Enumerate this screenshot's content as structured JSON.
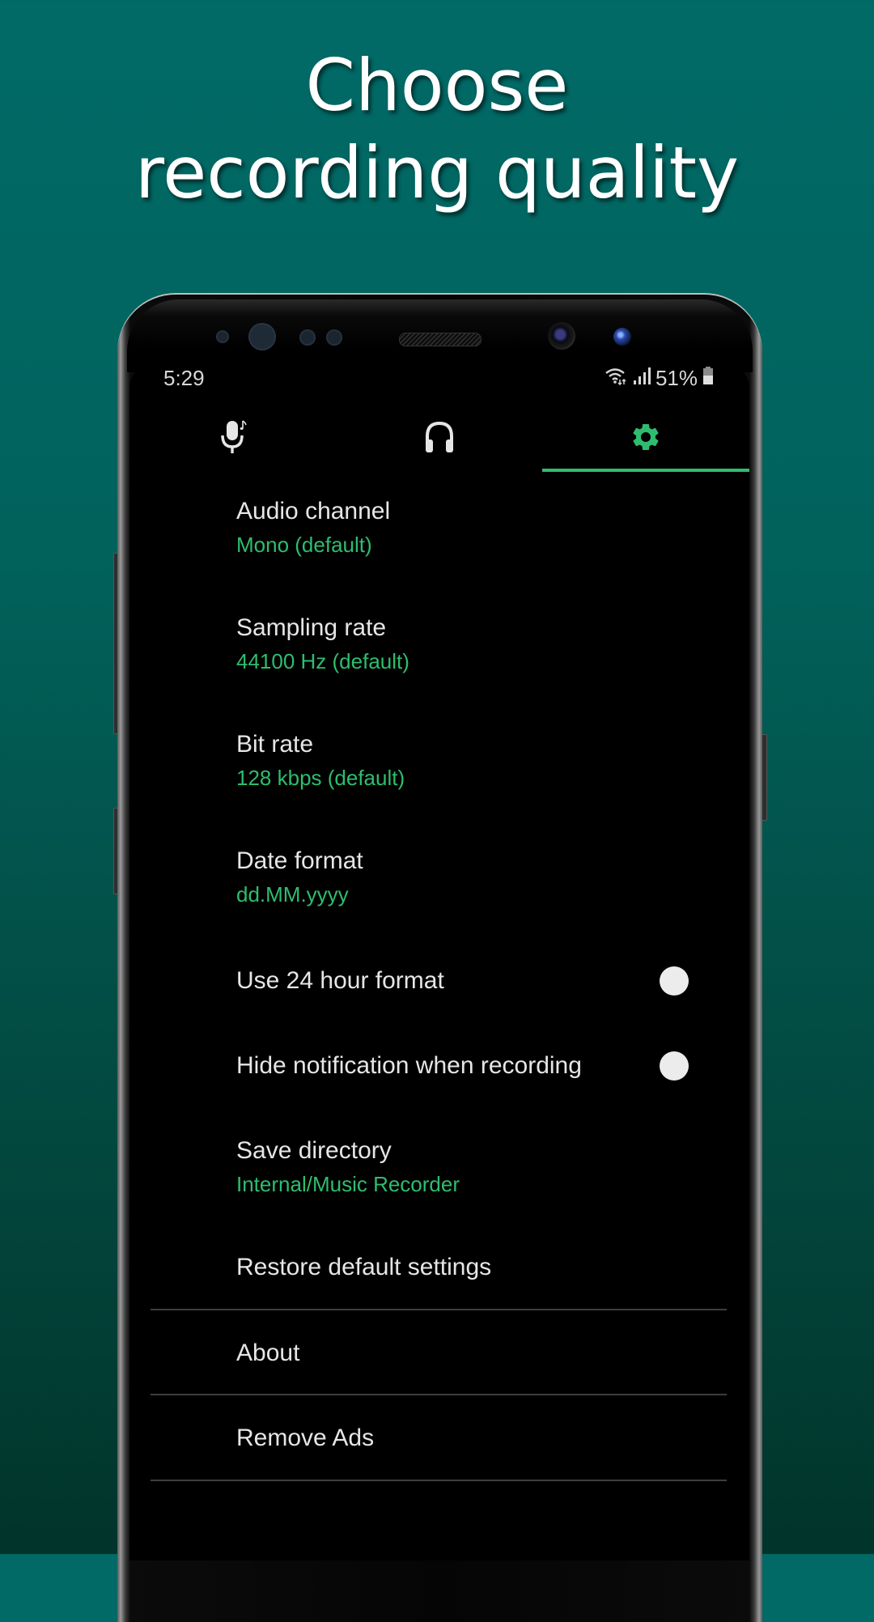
{
  "promo": {
    "headline_line1": "Choose",
    "headline_line2": "recording quality"
  },
  "status_bar": {
    "time": "5:29",
    "battery": "51%",
    "icons": [
      "wifi-icon",
      "signal-icon",
      "battery-icon"
    ]
  },
  "tabs": [
    {
      "name": "record",
      "icon": "microphone-icon",
      "active": false
    },
    {
      "name": "player",
      "icon": "headphones-icon",
      "active": false
    },
    {
      "name": "settings",
      "icon": "gear-icon",
      "active": true
    }
  ],
  "settings": {
    "audio_channel": {
      "title": "Audio channel",
      "value": "Mono (default)"
    },
    "sampling_rate": {
      "title": "Sampling rate",
      "value": "44100 Hz (default)"
    },
    "bit_rate": {
      "title": "Bit rate",
      "value": "128 kbps (default)"
    },
    "date_format": {
      "title": "Date format",
      "value": "dd.MM.yyyy"
    },
    "use_24_hour": {
      "title": "Use 24 hour format",
      "enabled": false
    },
    "hide_notification": {
      "title": "Hide notification when recording",
      "enabled": false
    },
    "save_directory": {
      "title": "Save directory",
      "value": "Internal/Music Recorder"
    },
    "restore_defaults": {
      "title": "Restore default settings"
    },
    "about": {
      "title": "About"
    },
    "remove_ads": {
      "title": "Remove Ads"
    }
  },
  "colors": {
    "accent": "#2ebd6e",
    "background_top": "#016a67",
    "background_bottom": "#01342a",
    "screen_bg": "#000000",
    "text_primary": "#e6e6e6"
  }
}
